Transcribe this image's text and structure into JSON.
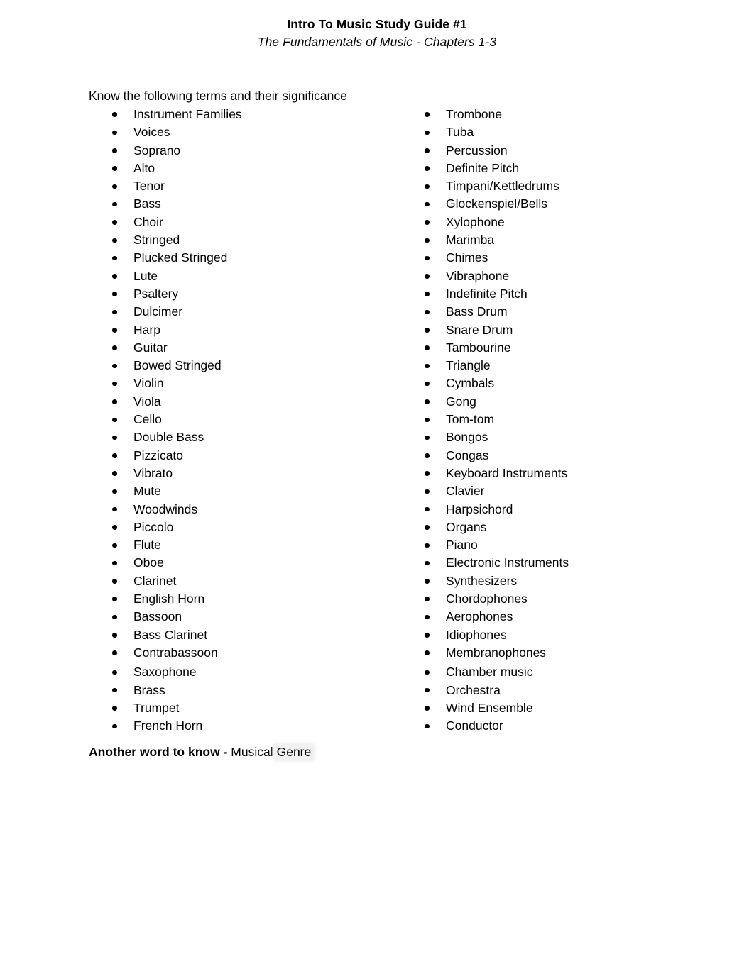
{
  "document": {
    "title": "Intro To Music Study Guide #1",
    "subtitle": "The Fundamentals of Music - Chapters 1-3",
    "intro": "Know the following terms and their significance"
  },
  "terms": {
    "left_column": [
      "Instrument Families",
      "Voices",
      "Soprano",
      "Alto",
      "Tenor",
      "Bass",
      "Choir",
      "Stringed",
      "Plucked Stringed",
      "Lute",
      "Psaltery",
      "Dulcimer",
      "Harp",
      "Guitar",
      "Bowed Stringed",
      "Violin",
      "Viola",
      "Cello",
      "Double Bass",
      "Pizzicato",
      "Vibrato",
      "Mute",
      "Woodwinds",
      "Piccolo",
      "Flute",
      "Oboe",
      "Clarinet",
      "English Horn",
      "Bassoon",
      "Bass Clarinet",
      "Contrabassoon",
      "Saxophone",
      "Brass",
      "Trumpet",
      "French Horn"
    ],
    "right_column": [
      "Trombone",
      "Tuba",
      "Percussion",
      "Definite Pitch",
      "Timpani/Kettledrums",
      "Glockenspiel/Bells",
      "Xylophone",
      "Marimba",
      "Chimes",
      "Vibraphone",
      "Indefinite Pitch",
      "Bass Drum",
      "Snare Drum",
      "Tambourine",
      "Triangle",
      "Cymbals",
      "Gong",
      "Tom-tom",
      "Bongos",
      "Congas",
      "Keyboard Instruments",
      "Clavier",
      "Harpsichord",
      "Organs",
      "Piano",
      "Electronic Instruments",
      "Synthesizers",
      "Chordophones",
      "Aerophones",
      "Idiophones",
      "Membranophones",
      "Chamber music",
      "Orchestra",
      "Wind Ensemble",
      "Conductor"
    ],
    "gap_before_index": 31
  },
  "footer": {
    "lead": "Another word to know - ",
    "value": "Musical",
    "highlighted_value": "Genre",
    "highlight_color": "#f1f1f1"
  }
}
